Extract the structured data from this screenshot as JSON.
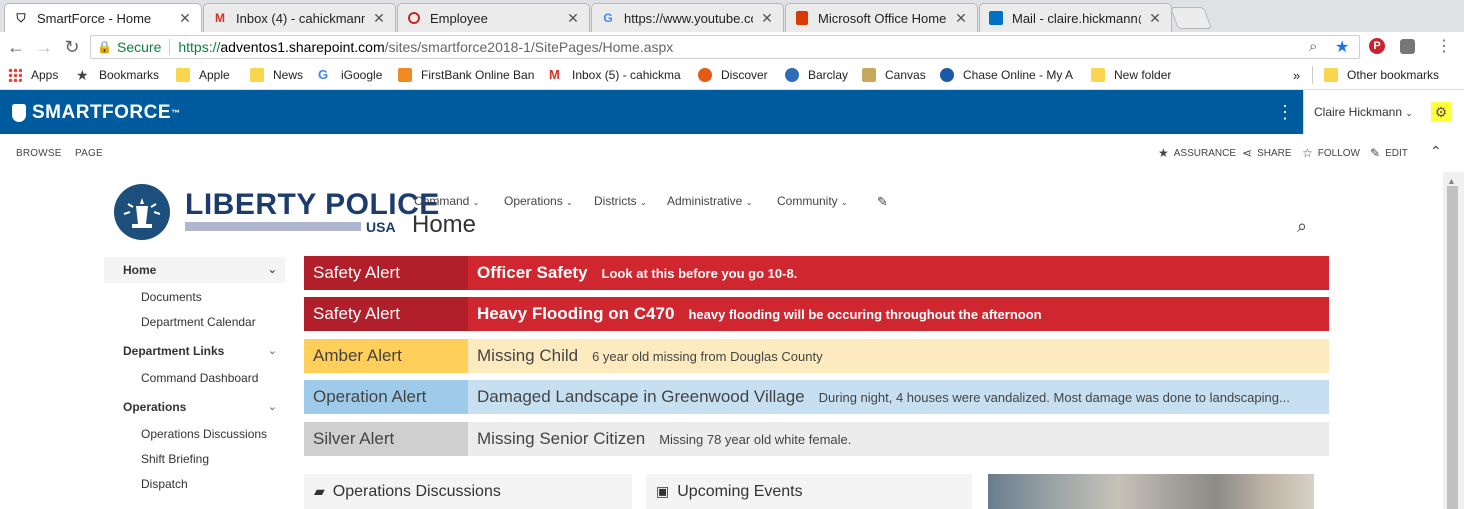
{
  "browser": {
    "tabs": [
      {
        "title": "SmartForce - Home",
        "icon": "shield-icon",
        "active": true
      },
      {
        "title": "Inbox (4) - cahickmann@",
        "icon": "gmail-icon"
      },
      {
        "title": "Employee",
        "icon": "circle-icon"
      },
      {
        "title": "https://www.youtube.com",
        "icon": "google-icon"
      },
      {
        "title": "Microsoft Office Home",
        "icon": "office-icon"
      },
      {
        "title": "Mail - claire.hickmann@a",
        "icon": "outlook-icon"
      }
    ],
    "address": {
      "secure_label": "Secure",
      "url_scheme": "https://",
      "url_domain": "adventos1.sharepoint.com",
      "url_path": "/sites/smartforce2018-1/SitePages/Home.aspx"
    },
    "bookmarks": [
      {
        "label": "Apps",
        "icon": "apps-grid-icon"
      },
      {
        "label": "Bookmarks",
        "icon": "star-icon"
      },
      {
        "label": "Apple",
        "icon": "folder-icon"
      },
      {
        "label": "News",
        "icon": "folder-icon"
      },
      {
        "label": "iGoogle",
        "icon": "google-icon"
      },
      {
        "label": "FirstBank Online Ban",
        "icon": "bank-icon"
      },
      {
        "label": "Inbox (5) - cahickma",
        "icon": "gmail-icon"
      },
      {
        "label": "Discover",
        "icon": "discover-icon"
      },
      {
        "label": "Barclay",
        "icon": "barclay-icon"
      },
      {
        "label": "Canvas",
        "icon": "canvas-icon"
      },
      {
        "label": "Chase Online - My A",
        "icon": "chase-icon"
      },
      {
        "label": "New folder",
        "icon": "folder-icon"
      }
    ],
    "overflow_label": "»",
    "other_bookmarks": "Other bookmarks"
  },
  "suite": {
    "brand": "SMARTFORCE",
    "brand_mark": "™",
    "user": "Claire Hickmann"
  },
  "ribbon": {
    "tabs": [
      "BROWSE",
      "PAGE"
    ],
    "actions": [
      {
        "label": "ASSURANCE",
        "icon": "star-filled-icon"
      },
      {
        "label": "SHARE",
        "icon": "share-icon"
      },
      {
        "label": "FOLLOW",
        "icon": "star-outline-icon"
      },
      {
        "label": "EDIT",
        "icon": "pencil-icon"
      }
    ]
  },
  "site": {
    "logo_title": "LIBERTY POLICE",
    "logo_sub": "USA",
    "page_title": "Home",
    "topnav": [
      "Command",
      "Operations",
      "Districts",
      "Administrative",
      "Community"
    ]
  },
  "leftnav": {
    "sections": [
      {
        "label": "Home",
        "items": [
          "Documents",
          "Department Calendar"
        ]
      },
      {
        "label": "Department Links",
        "items": [
          "Command Dashboard"
        ]
      },
      {
        "label": "Operations",
        "items": [
          "Operations Discussions",
          "Shift Briefing",
          "Dispatch"
        ]
      }
    ]
  },
  "alerts": [
    {
      "type": "Safety Alert",
      "title": "Officer Safety",
      "message": "Look at this before you go 10-8.",
      "type_bg": "#b01f2a",
      "bg": "#d0262f",
      "color": "#ffffff",
      "bold": true
    },
    {
      "type": "Safety Alert",
      "title": "Heavy Flooding on C470",
      "message": "heavy flooding will be occuring throughout the afternoon",
      "type_bg": "#b01f2a",
      "bg": "#d0262f",
      "color": "#ffffff",
      "bold": true
    },
    {
      "type": "Amber Alert",
      "title": "Missing Child",
      "message": "6 year old missing from Douglas County",
      "type_bg": "#ffcf59",
      "bg": "#fdebbf",
      "color": "#444444",
      "bold": false
    },
    {
      "type": "Operation Alert",
      "title": "Damaged Landscape in Greenwood Village",
      "message": "During night, 4 houses were vandalized. Most damage was done to landscaping...",
      "type_bg": "#9fcbeb",
      "bg": "#c6e0f2",
      "color": "#444444",
      "bold": false
    },
    {
      "type": "Silver Alert",
      "title": "Missing Senior Citizen",
      "message": "Missing 78 year old white female.",
      "type_bg": "#cfcfcf",
      "bg": "#ececec",
      "color": "#444444",
      "bold": false
    }
  ],
  "webparts": [
    {
      "title": "Operations Discussions",
      "icon": "chat-icon"
    },
    {
      "title": "Upcoming Events",
      "icon": "calendar-icon"
    }
  ]
}
